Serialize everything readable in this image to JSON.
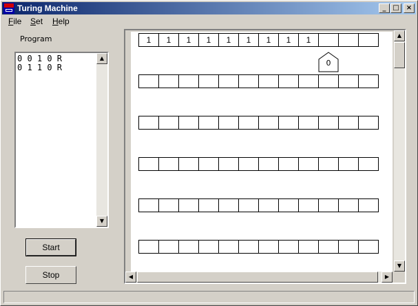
{
  "window": {
    "title": "Turing Machine"
  },
  "titlebar": {
    "minimize": "_",
    "maximize": "□",
    "close": "×"
  },
  "menu": [
    "File",
    "Set",
    "Help"
  ],
  "program": {
    "label": "Program",
    "lines": [
      "0 0 1 0 R",
      "0 1 1 0 R"
    ]
  },
  "buttons": {
    "start": "Start",
    "stop": "Stop"
  },
  "tape": {
    "rows": [
      [
        "1",
        "1",
        "1",
        "1",
        "1",
        "1",
        "1",
        "1",
        "1",
        "",
        "",
        ""
      ],
      [
        "",
        "",
        "",
        "",
        "",
        "",
        "",
        "",
        "",
        "",
        "",
        ""
      ],
      [
        "",
        "",
        "",
        "",
        "",
        "",
        "",
        "",
        "",
        "",
        "",
        ""
      ],
      [
        "",
        "",
        "",
        "",
        "",
        "",
        "",
        "",
        "",
        "",
        "",
        ""
      ],
      [
        "",
        "",
        "",
        "",
        "",
        "",
        "",
        "",
        "",
        "",
        "",
        ""
      ],
      [
        "",
        "",
        "",
        "",
        "",
        "",
        "",
        "",
        "",
        "",
        "",
        ""
      ]
    ],
    "head": {
      "row": 0,
      "position": 9,
      "state": "0"
    }
  },
  "icons": {
    "app": "turing-app-icon",
    "scroll_up": "arrow-up-icon",
    "scroll_down": "arrow-down-icon",
    "scroll_left": "arrow-left-icon",
    "scroll_right": "arrow-right-icon"
  },
  "colors": {
    "titlebar_start": "#0a246a",
    "titlebar_end": "#a6caf0",
    "face": "#d4d0c8"
  }
}
